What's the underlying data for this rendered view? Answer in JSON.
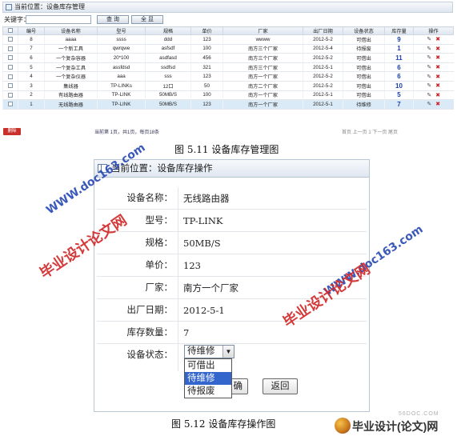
{
  "list_page": {
    "location": "当前位置：设备库存管理",
    "keyword_label": "关键字：",
    "keyword_value": "",
    "search_button": "查 询",
    "all_button": "全 显",
    "columns": [
      "编号",
      "设备名称",
      "型号",
      "规格",
      "单价",
      "厂家",
      "出厂日期",
      "设备状态",
      "库存量",
      "操作"
    ],
    "rows": [
      {
        "id": "8",
        "name": "aaaa",
        "model": "ssss",
        "spec": "ddd",
        "price": "123",
        "maker": "wwww",
        "date": "2012-5-2",
        "status": "可借出",
        "stock": "9"
      },
      {
        "id": "7",
        "name": "一个新工具",
        "model": "qwrqwe",
        "spec": "asfsdf",
        "price": "100",
        "maker": "南方三个厂家",
        "date": "2012-5-4",
        "status": "待报废",
        "stock": "1"
      },
      {
        "id": "6",
        "name": "一个复杂容器",
        "model": "20*100",
        "spec": "asdfasd",
        "price": "456",
        "maker": "南方三个厂家",
        "date": "2012-5-2",
        "status": "可借出",
        "stock": "11"
      },
      {
        "id": "5",
        "name": "一个复杂工具",
        "model": "assfdsd",
        "spec": "ssdfsd",
        "price": "321",
        "maker": "南方三个厂家",
        "date": "2012-5-1",
        "status": "可借出",
        "stock": "6"
      },
      {
        "id": "4",
        "name": "一个复杂仪器",
        "model": "aaa",
        "spec": "sss",
        "price": "123",
        "maker": "南方一个厂家",
        "date": "2012-5-2",
        "status": "可借出",
        "stock": "6"
      },
      {
        "id": "3",
        "name": "集线器",
        "model": "TP-LINKs",
        "spec": "12口",
        "price": "50",
        "maker": "南方二个厂家",
        "date": "2012-5-2",
        "status": "可借出",
        "stock": "10"
      },
      {
        "id": "2",
        "name": "有线路由器",
        "model": "TP-LINK",
        "spec": "50MB/S",
        "price": "100",
        "maker": "南方一个厂家",
        "date": "2012-5-1",
        "status": "可借出",
        "stock": "5"
      },
      {
        "id": "1",
        "name": "无线路由器",
        "model": "TP-LINK",
        "spec": "50MB/S",
        "price": "123",
        "maker": "南方一个厂家",
        "date": "2012-5-1",
        "status": "待维修",
        "stock": "7"
      }
    ],
    "delete_button": "删除",
    "page_summary": "当前第 1页，共1页，每页18条",
    "page_nav": "首页 上一页 1 下一页 尾页"
  },
  "caption_top": "图 5.11  设备库存管理图",
  "form_page": {
    "location": "当前位置：设备库存操作",
    "fields": [
      {
        "label": "设备名称：",
        "value": "无线路由器"
      },
      {
        "label": "型号：",
        "value": "TP-LINK"
      },
      {
        "label": "规格：",
        "value": "50MB/S"
      },
      {
        "label": "单价：",
        "value": "123"
      },
      {
        "label": "厂家：",
        "value": "南方一个厂家"
      },
      {
        "label": "出厂日期：",
        "value": "2012-5-1"
      },
      {
        "label": "库存数量：",
        "value": "7"
      }
    ],
    "status_label": "设备状态：",
    "status_selected": "待维修",
    "status_options": [
      "可借出",
      "待维修",
      "待报废"
    ],
    "submit_button": "确",
    "back_button": "返回"
  },
  "caption_bottom": "图 5.12  设备库存操作图",
  "watermarks": {
    "site": "WWW.doc163.com",
    "name": "毕业设计论文网",
    "logo_text": "毕业设计(论文)网",
    "logo_site": "56DOC.COM"
  }
}
